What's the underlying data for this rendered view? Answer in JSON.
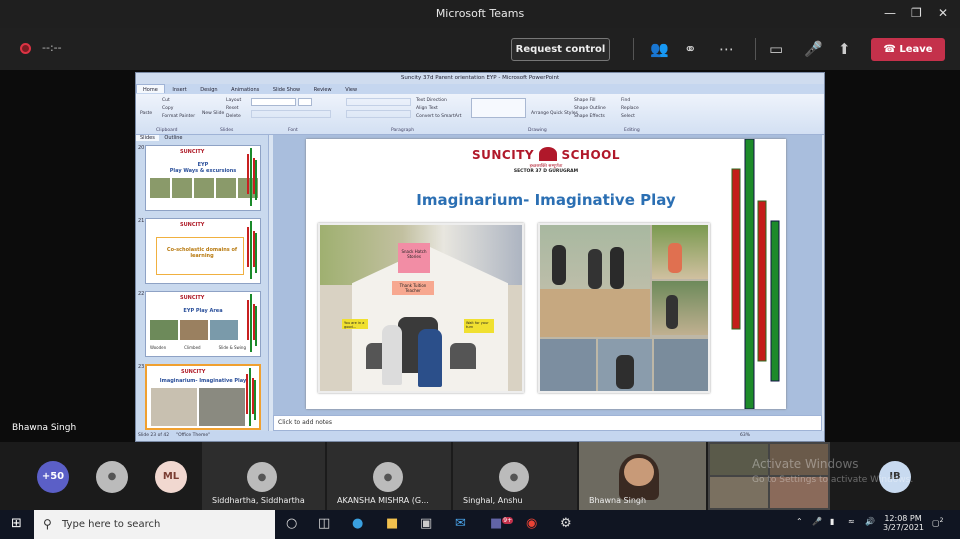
{
  "window": {
    "title": "Microsoft Teams"
  },
  "call": {
    "timer": "--:--",
    "request_control": "Request control",
    "leave": "Leave"
  },
  "ppt": {
    "title": "Suncity 37d Parent orientation EYP - Microsoft PowerPoint",
    "tabs": [
      "Home",
      "Insert",
      "Design",
      "Animations",
      "Slide Show",
      "Review",
      "View"
    ],
    "groups": [
      "Clipboard",
      "Slides",
      "Font",
      "Paragraph",
      "Drawing",
      "Editing"
    ],
    "ribbon_labels": {
      "paste": "Paste",
      "cut": "Cut",
      "copy": "Copy",
      "format_painter": "Format Painter",
      "new_slide": "New Slide",
      "layout": "Layout",
      "reset": "Reset",
      "delete": "Delete",
      "text_direction": "Text Direction",
      "align_text": "Align Text",
      "convert": "Convert to SmartArt",
      "arrange": "Arrange",
      "quick_styles": "Quick Styles",
      "shape_fill": "Shape Fill",
      "shape_outline": "Shape Outline",
      "shape_effects": "Shape Effects",
      "find": "Find",
      "replace": "Replace",
      "select": "Select"
    },
    "pane_tabs": [
      "Slides",
      "Outline"
    ],
    "notes": "Click to add notes",
    "status": {
      "slide": "Slide 23 of 42",
      "theme": "\"Office Theme\"",
      "zoom": "63%"
    }
  },
  "slide": {
    "logo_a": "SUNCITY",
    "logo_b": "SCHOOL",
    "logo_hindi": "इच्छाशक्ति सम्पूर्णता",
    "logo_sub": "SECTOR 37 D GURUGRAM",
    "title": "Imaginarium- Imaginative Play",
    "signs": [
      "Snack Hatch Stories",
      "Thank Tuition Teacher",
      "You are in a good...",
      "Wait for your turn"
    ]
  },
  "thumbnails": [
    {
      "num": "20",
      "title": "EYP",
      "subtitle": "Play Ways & excursions"
    },
    {
      "num": "21",
      "title": "Co-scholastic domains of learning"
    },
    {
      "num": "22",
      "title": "EYP Play Area",
      "captions": [
        "Wooden",
        "Climbed",
        "Slide & Swing"
      ]
    },
    {
      "num": "23",
      "title": "Imaginarium- Imaginative Play"
    }
  ],
  "presenter": {
    "name": "Bhawna Singh"
  },
  "roster": {
    "overflow": "+50",
    "initials_ml": "ML",
    "initials_ib": "IB",
    "people": [
      "Siddhartha, Siddhartha",
      "AKANSHA MISHRA (G...",
      "Singhal, Anshu",
      "Bhawna Singh"
    ]
  },
  "watermark": {
    "line1": "Activate Windows",
    "line2": "Go to Settings to activate Windows."
  },
  "taskbar": {
    "search_placeholder": "Type here to search",
    "time": "12:08 PM",
    "date": "3/27/2021",
    "teams_badge": "9+",
    "notif_badge": "2"
  }
}
